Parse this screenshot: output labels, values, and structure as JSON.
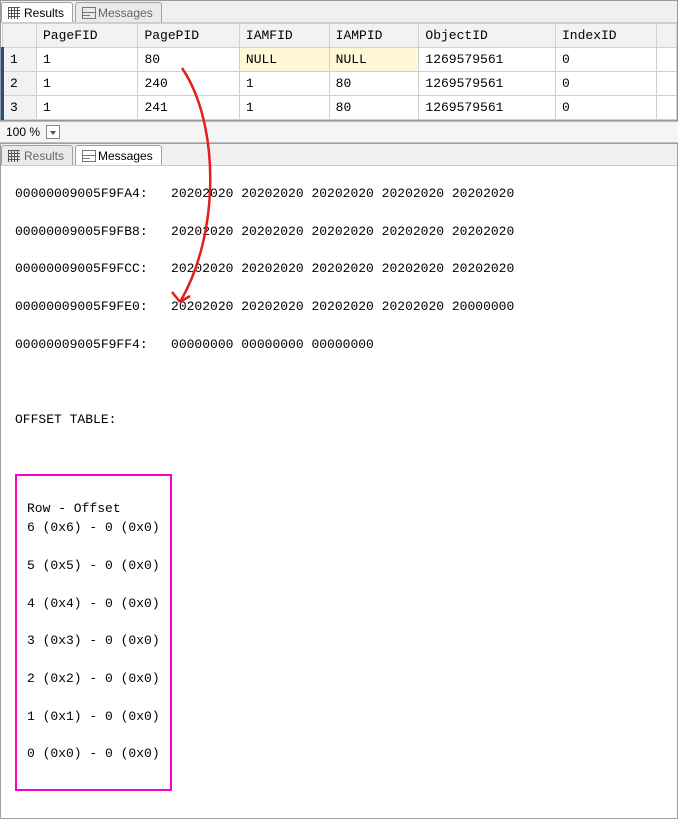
{
  "top": {
    "tabs": {
      "results": "Results",
      "messages": "Messages"
    },
    "columns": [
      "PageFID",
      "PagePID",
      "IAMFID",
      "IAMPID",
      "ObjectID",
      "IndexID"
    ],
    "rows": [
      {
        "n": "1",
        "PageFID": "1",
        "PagePID": "80",
        "IAMFID": "NULL",
        "IAMPID": "NULL",
        "ObjectID": "1269579561",
        "IndexID": "0"
      },
      {
        "n": "2",
        "PageFID": "1",
        "PagePID": "240",
        "IAMFID": "1",
        "IAMPID": "80",
        "ObjectID": "1269579561",
        "IndexID": "0"
      },
      {
        "n": "3",
        "PageFID": "1",
        "PagePID": "241",
        "IAMFID": "1",
        "IAMPID": "80",
        "ObjectID": "1269579561",
        "IndexID": "0"
      }
    ]
  },
  "zoom": {
    "label": "100 %"
  },
  "bottom": {
    "tabs": {
      "results": "Results",
      "messages": "Messages"
    },
    "hex": [
      "00000009005F9FA4:   20202020 20202020 20202020 20202020 20202020",
      "00000009005F9FB8:   20202020 20202020 20202020 20202020 20202020",
      "00000009005F9FCC:   20202020 20202020 20202020 20202020 20202020",
      "00000009005F9FE0:   20202020 20202020 20202020 20202020 20000000",
      "00000009005F9FF4:   00000000 00000000 00000000"
    ],
    "offset_title": "OFFSET TABLE:",
    "offset_header": "Row - Offset",
    "offset_rows": [
      "6 (0x6) - 0 (0x0)",
      "5 (0x5) - 0 (0x0)",
      "4 (0x4) - 0 (0x0)",
      "3 (0x3) - 0 (0x0)",
      "2 (0x2) - 0 (0x0)",
      "1 (0x1) - 0 (0x0)",
      "0 (0x0) - 0 (0x0)"
    ]
  }
}
